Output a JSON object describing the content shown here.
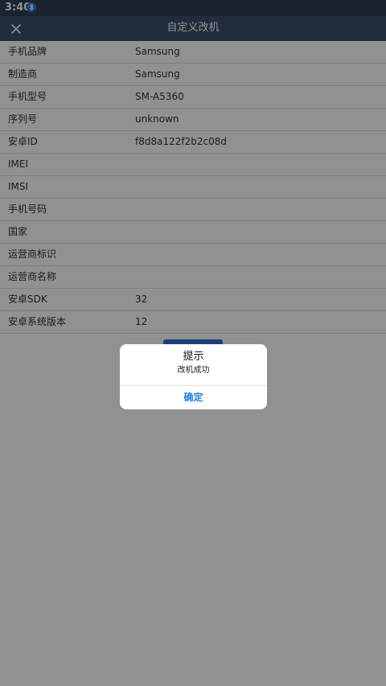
{
  "status_bar": {
    "time": "3:40",
    "notification_icon": "bluetooth-icon"
  },
  "header": {
    "title": "自定义改机",
    "close_icon": "close-icon"
  },
  "rows": [
    {
      "label": "手机品牌",
      "value": "Samsung"
    },
    {
      "label": "制造商",
      "value": "Samsung"
    },
    {
      "label": "手机型号",
      "value": "SM-A5360"
    },
    {
      "label": "序列号",
      "value": "unknown"
    },
    {
      "label": "安卓ID",
      "value": "f8d8a122f2b2c08d"
    },
    {
      "label": "IMEI",
      "value": ""
    },
    {
      "label": "IMSI",
      "value": ""
    },
    {
      "label": "手机号码",
      "value": ""
    },
    {
      "label": "国家",
      "value": ""
    },
    {
      "label": "运营商标识",
      "value": ""
    },
    {
      "label": "运营商名称",
      "value": ""
    },
    {
      "label": "安卓SDK",
      "value": "32"
    },
    {
      "label": "安卓系统版本",
      "value": "12"
    }
  ],
  "dialog": {
    "title": "提示",
    "message": "改机成功",
    "confirm_label": "确定"
  },
  "colors": {
    "status_bar": "#2e3e52",
    "app_bar": "#3b4f6a",
    "accent": "#1e7ee6",
    "primary_button": "#2f6fd6"
  }
}
